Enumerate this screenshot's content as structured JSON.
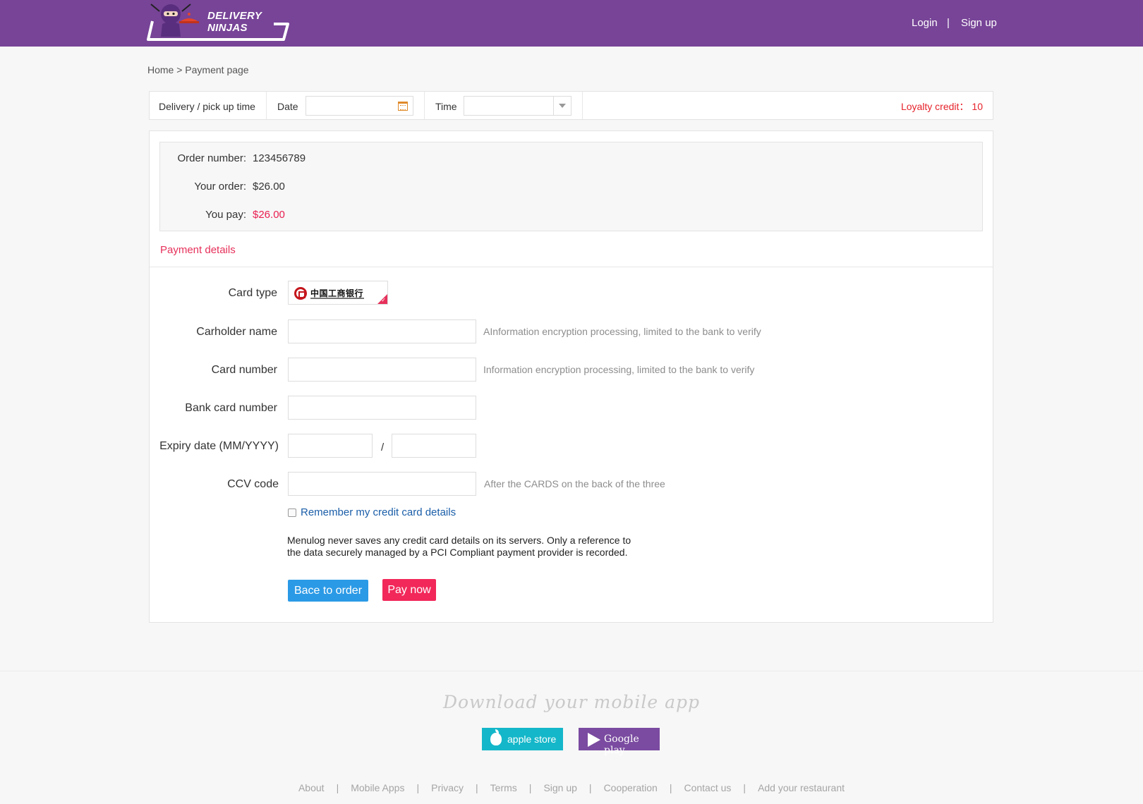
{
  "header": {
    "brand": "DELIVERY NINJAS",
    "login": "Login",
    "separator": "|",
    "signup": "Sign up"
  },
  "breadcrumb": "Home > Payment page",
  "timebar": {
    "label": "Delivery / pick up time",
    "date_label": "Date",
    "date_value": "",
    "time_label": "Time",
    "time_value": "",
    "loyalty_label": "Loyalty credit：",
    "loyalty_value": "10"
  },
  "summary": {
    "order_number_label": "Order number:",
    "order_number": "123456789",
    "your_order_label": "Your order:",
    "your_order": "$26.00",
    "you_pay_label": "You pay:",
    "you_pay": "$26.00"
  },
  "payment": {
    "title": "Payment details",
    "card_type_label": "Card type",
    "card_type_bank": "中国工商银行",
    "cardholder_label": "Carholder name",
    "cardholder_hint": "AInformation encryption processing, limited to the bank to verify",
    "card_number_label": "Card number",
    "card_number_hint": "Information encryption processing, limited to the bank to verify",
    "bank_card_label": "Bank card number",
    "expiry_label": "Expiry date (MM/YYYY)",
    "expiry_separator": "/",
    "ccv_label": "CCV code",
    "ccv_hint": "After the CARDS on the back of the three",
    "remember_label": "Remember my credit card details",
    "remember_checked": false,
    "notice_line1": "Menulog never saves any credit card details on its servers. Only a reference to",
    "notice_line2": "the data securely managed by a PCI Compliant payment provider is recorded.",
    "back_button": "Bace to order",
    "pay_button": "Pay now"
  },
  "footer": {
    "download_title": "Download your mobile app",
    "apple_store": "apple store",
    "google_play": "Google play",
    "links": [
      "About",
      "Mobile Apps",
      "Privacy",
      "Terms",
      "Sign up",
      "Cooperation",
      "Contact us",
      "Add your restaurant"
    ]
  },
  "colors": {
    "header_bg": "#774497",
    "accent_red": "#e91e50",
    "button_blue": "#2b9ae6",
    "button_red": "#f2285a",
    "apple_btn": "#14b7c9",
    "google_btn": "#7a4ba0"
  }
}
